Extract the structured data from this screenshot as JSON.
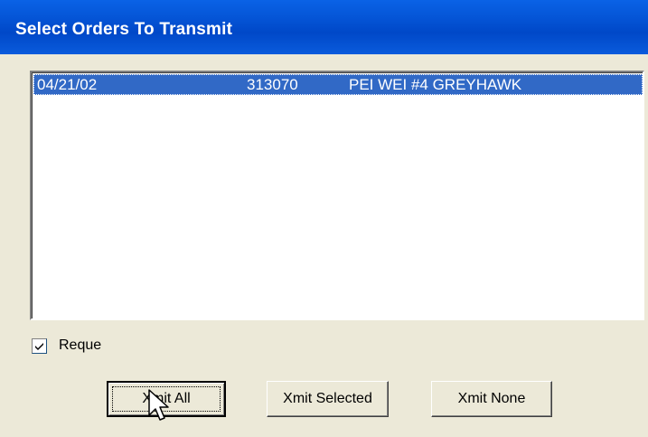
{
  "window": {
    "title": "Select Orders To Transmit"
  },
  "orders": {
    "rows": [
      {
        "date": "04/21/02",
        "number": "313070",
        "name": "PEI WEI #4 GREYHAWK"
      }
    ]
  },
  "reque": {
    "label": "Reque",
    "checked": true
  },
  "buttons": {
    "xmit_all": "Xmit All",
    "xmit_selected": "Xmit Selected",
    "xmit_none": "Xmit None"
  },
  "colors": {
    "title_bar": "#0054e3",
    "selection": "#3169c6",
    "dialog_bg": "#ece9d8"
  },
  "icons": {
    "cursor": "mouse-pointer-icon",
    "check": "checkmark-icon"
  }
}
